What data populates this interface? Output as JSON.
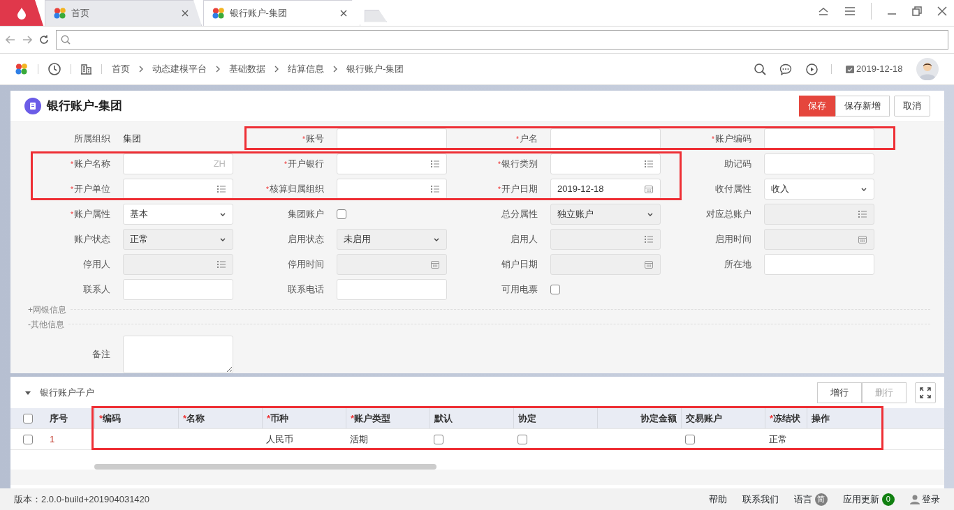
{
  "browser": {
    "tabs": [
      {
        "kind": "logo"
      },
      {
        "kind": "page",
        "label": "首页",
        "selected": false
      },
      {
        "kind": "page",
        "label": "银行账户-集团",
        "selected": true
      },
      {
        "kind": "new"
      }
    ]
  },
  "header": {
    "breadcrumbs": [
      "首页",
      "动态建模平台",
      "基础数据",
      "结算信息",
      "银行账户-集团"
    ],
    "date": "2019-12-18"
  },
  "page": {
    "title": "银行账户-集团",
    "buttons": [
      {
        "label": "保存",
        "primary": true,
        "grouped": true
      },
      {
        "label": "保存新增",
        "primary": false,
        "grouped": true
      },
      {
        "label": "取消",
        "primary": false,
        "grouped": false
      }
    ]
  },
  "form": {
    "rows": [
      [
        {
          "label": "所属组织",
          "kind": "static",
          "value": "集团"
        },
        {
          "mark": "*",
          "label": "账号",
          "kind": "text",
          "disabled": false
        },
        {
          "mark": "*",
          "label": "户名",
          "kind": "text",
          "disabled": false
        },
        {
          "mark": "*",
          "label": "账户编码",
          "kind": "text",
          "disabled": false
        }
      ],
      [
        {
          "mark": "*",
          "label": "账户名称",
          "kind": "text",
          "suffix": "ZH",
          "disabled": false
        },
        {
          "mark": "*",
          "label": "开户银行",
          "kind": "lookup",
          "disabled": false
        },
        {
          "mark": "*",
          "label": "银行类别",
          "kind": "lookup",
          "disabled": false
        },
        {
          "label": "助记码",
          "kind": "text",
          "disabled": false
        }
      ],
      [
        {
          "mark": "*",
          "label": "开户单位",
          "kind": "lookup",
          "disabled": false
        },
        {
          "mark": "*",
          "label": "核算归属组织",
          "kind": "lookup",
          "disabled": false
        },
        {
          "mark": "*",
          "label": "开户日期",
          "kind": "date",
          "value": "2019-12-18",
          "disabled": false
        },
        {
          "label": "收付属性",
          "kind": "select",
          "value": "收入",
          "disabled": false
        }
      ],
      [
        {
          "mark": "*",
          "label": "账户属性",
          "kind": "select",
          "value": "基本",
          "disabled": false
        },
        {
          "label": "集团账户",
          "kind": "checkbox",
          "checked": false
        },
        {
          "label": "总分属性",
          "kind": "select",
          "value": "独立账户",
          "disabled": true
        },
        {
          "label": "对应总账户",
          "kind": "lookup",
          "disabled": true
        }
      ],
      [
        {
          "label": "账户状态",
          "kind": "select",
          "value": "正常",
          "disabled": true
        },
        {
          "label": "启用状态",
          "kind": "select",
          "value": "未启用",
          "disabled": true
        },
        {
          "label": "启用人",
          "kind": "lookup",
          "disabled": true
        },
        {
          "label": "启用时间",
          "kind": "date",
          "disabled": true
        }
      ],
      [
        {
          "label": "停用人",
          "kind": "lookup",
          "disabled": true
        },
        {
          "label": "停用时间",
          "kind": "date",
          "disabled": true
        },
        {
          "label": "销户日期",
          "kind": "date",
          "disabled": true
        },
        {
          "label": "所在地",
          "kind": "text",
          "disabled": false
        }
      ],
      [
        {
          "label": "联系人",
          "kind": "text",
          "disabled": false
        },
        {
          "label": "联系电话",
          "kind": "text",
          "disabled": false
        },
        {
          "label": "可用电票",
          "kind": "checkbox",
          "checked": false
        }
      ]
    ],
    "sections": [
      {
        "toggle": "+",
        "label": "网银信息"
      },
      {
        "toggle": "-",
        "label": "其他信息"
      }
    ],
    "remark": {
      "label": "备注"
    }
  },
  "subtable": {
    "title": "银行账户子户",
    "expanded": true,
    "buttons": [
      {
        "label": "增行",
        "disabled": false
      },
      {
        "label": "删行",
        "disabled": true
      }
    ],
    "select_all": {
      "checked": false
    },
    "columns": [
      {
        "kind": "text",
        "label": "序号"
      },
      {
        "kind": "text",
        "mark": "*",
        "label": "编码"
      },
      {
        "kind": "text",
        "mark": "*",
        "label": "名称"
      },
      {
        "kind": "text",
        "mark": "*",
        "label": "币种"
      },
      {
        "kind": "text",
        "mark": "*",
        "label": "账户类型"
      },
      {
        "kind": "text",
        "label": "默认"
      },
      {
        "kind": "text",
        "label": "协定"
      },
      {
        "kind": "amount",
        "label": "协定金额"
      },
      {
        "kind": "text",
        "label": "交易账户"
      },
      {
        "kind": "text",
        "mark": "*",
        "label": "冻结状"
      },
      {
        "kind": "text",
        "label": "操作"
      }
    ],
    "rows": [
      {
        "checked": false,
        "cells": [
          {
            "kind": "index",
            "text": "1"
          },
          {
            "kind": "empty"
          },
          {
            "kind": "empty"
          },
          {
            "kind": "text",
            "text": "人民币"
          },
          {
            "kind": "text",
            "text": "活期"
          },
          {
            "kind": "checkbox",
            "checked": false
          },
          {
            "kind": "checkbox",
            "checked": false
          },
          {
            "kind": "empty"
          },
          {
            "kind": "checkbox",
            "checked": false
          },
          {
            "kind": "text",
            "text": "正常"
          },
          {
            "kind": "empty"
          }
        ]
      }
    ]
  },
  "highlights": [
    {
      "kind": "form-top-row"
    },
    {
      "kind": "form-required-block"
    },
    {
      "kind": "table-columns"
    }
  ],
  "footer": {
    "version": "版本：2.0.0-build+201904031420",
    "links": [
      {
        "kind": "link",
        "label": "帮助"
      },
      {
        "kind": "link",
        "label": "联系我们"
      },
      {
        "kind": "badge",
        "label": "语言",
        "badge": "简",
        "color": "#808080"
      },
      {
        "kind": "badge",
        "label": "应用更新",
        "badge": "0",
        "color": "#118011"
      },
      {
        "kind": "user",
        "label": "登录"
      }
    ]
  }
}
